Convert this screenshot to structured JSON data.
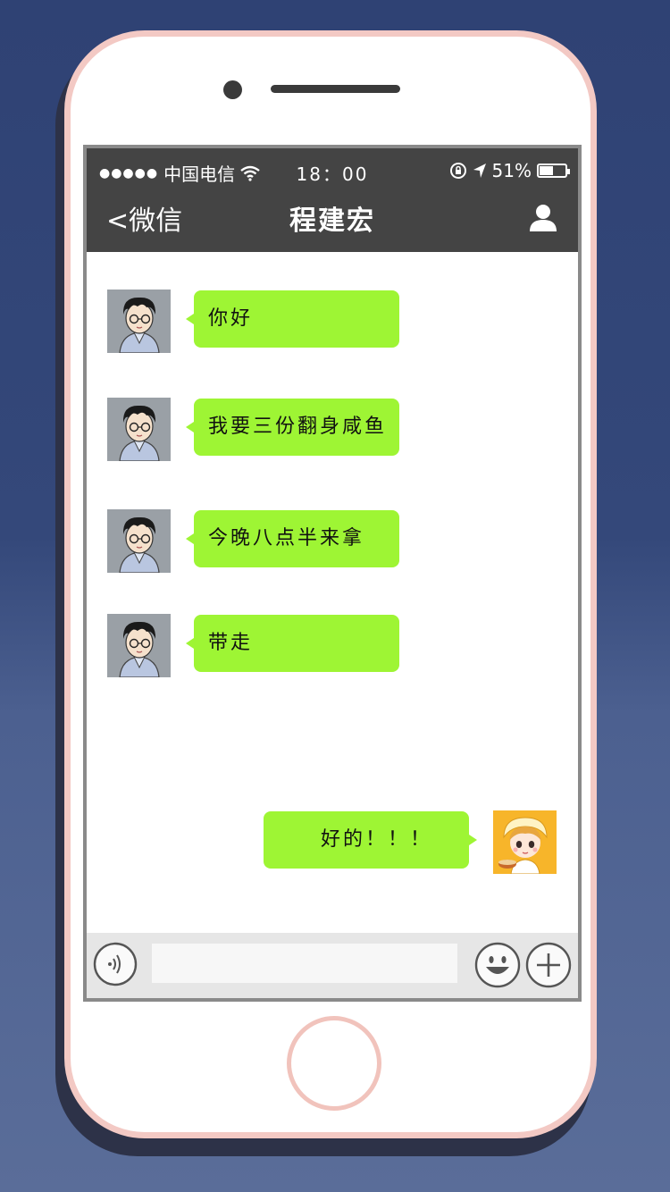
{
  "status_bar": {
    "signal": "●●●●●",
    "carrier": "中国电信",
    "time": "18：00",
    "battery": "51%",
    "battery_level": 0.51
  },
  "nav": {
    "back_label": "<微信",
    "title": "程建宏",
    "profile_icon": "person-icon"
  },
  "messages": [
    {
      "side": "left",
      "text": "你好",
      "avatar": "boy-avatar"
    },
    {
      "side": "left",
      "text": "我要三份翻身咸鱼",
      "avatar": "boy-avatar"
    },
    {
      "side": "left",
      "text": "今晚八点半来拿",
      "avatar": "boy-avatar"
    },
    {
      "side": "left",
      "text": "带走",
      "avatar": "boy-avatar"
    },
    {
      "side": "right",
      "text": "好的！！！",
      "avatar": "girl-avatar"
    }
  ],
  "input_bar": {
    "voice_icon": "voice-icon",
    "input_value": "",
    "emoji_icon": "emoji-icon",
    "plus_icon": "plus-icon"
  },
  "colors": {
    "bubble": "#9ef534",
    "topbar": "#444444",
    "phone_frame": "#f3c9c4"
  }
}
